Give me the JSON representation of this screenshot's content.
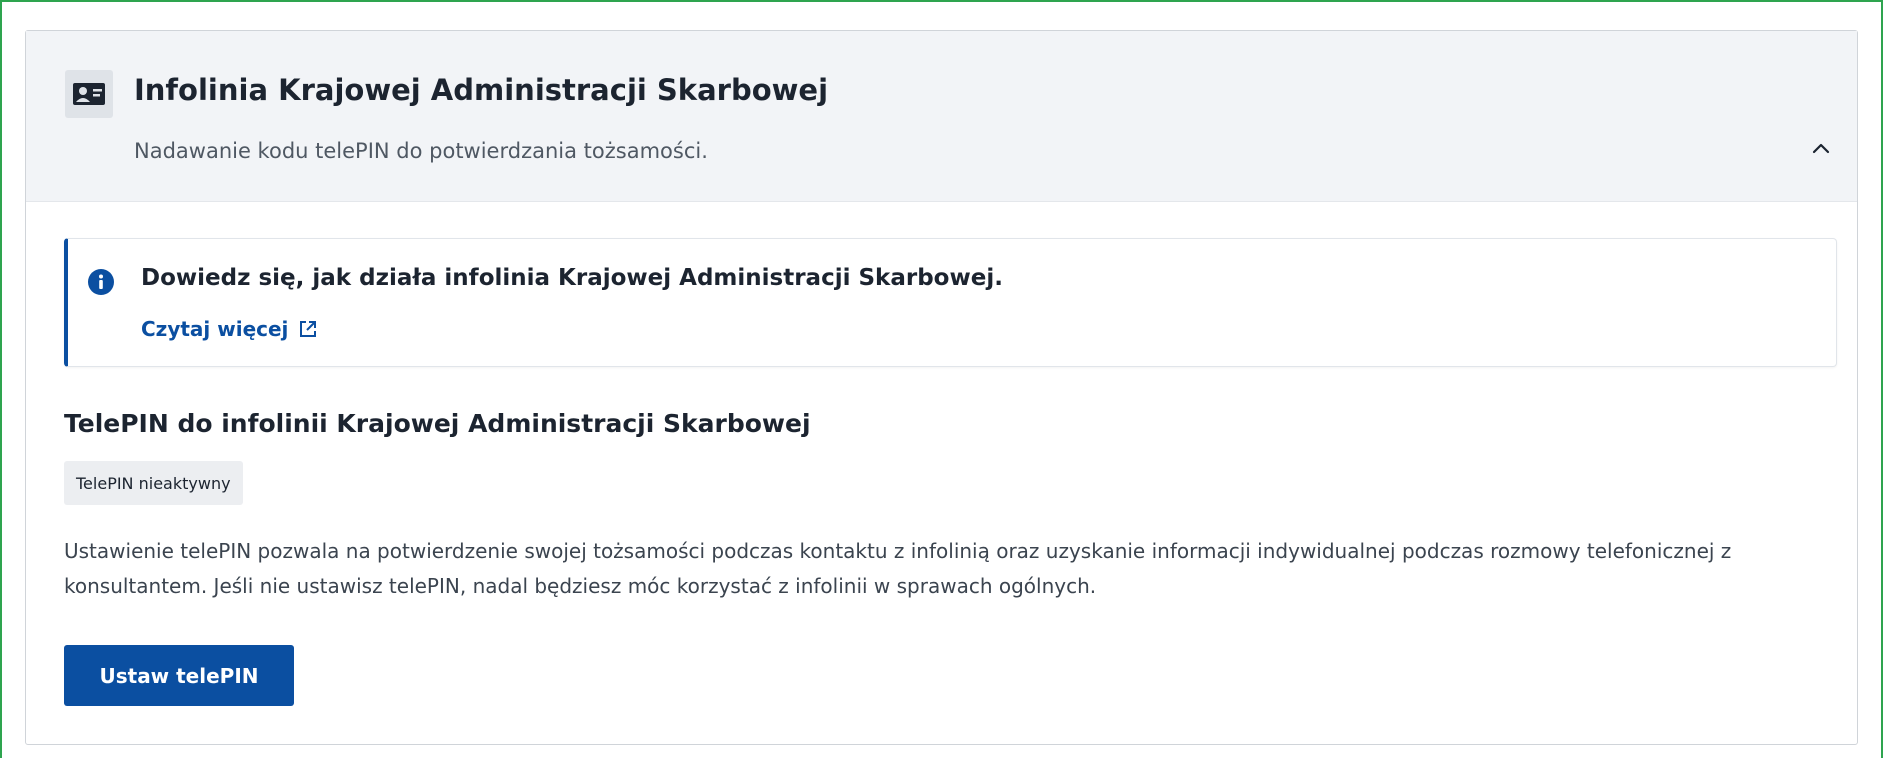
{
  "header": {
    "icon": "contact-card-icon",
    "title": "Infolinia Krajowej Administracji Skarbowej",
    "subtitle": "Nadawanie kodu telePIN do potwierdzania tożsamości.",
    "toggle_icon": "chevron-up-icon"
  },
  "info": {
    "icon": "info-icon",
    "title": "Dowiedz się, jak działa infolinia Krajowej Administracji Skarbowej.",
    "link_label": "Czytaj więcej",
    "link_icon": "external-link-icon"
  },
  "telepin": {
    "title": "TelePIN do infolinii Krajowej Administracji Skarbowej",
    "status": "TelePIN nieaktywny",
    "description": "Ustawienie telePIN pozwala na potwierdzenie swojej tożsamości podczas kontaktu z infolinią oraz uzyskanie informacji indywidualnej podczas rozmowy telefonicznej z konsultantem. Jeśli nie ustawisz telePIN, nadal będziesz móc korzystać z infolinii w sprawach ogólnych.",
    "button_label": "Ustaw telePIN"
  },
  "colors": {
    "accent": "#0b4fa1",
    "header_background": "#f2f4f7",
    "frame_border": "#2ea44f"
  }
}
